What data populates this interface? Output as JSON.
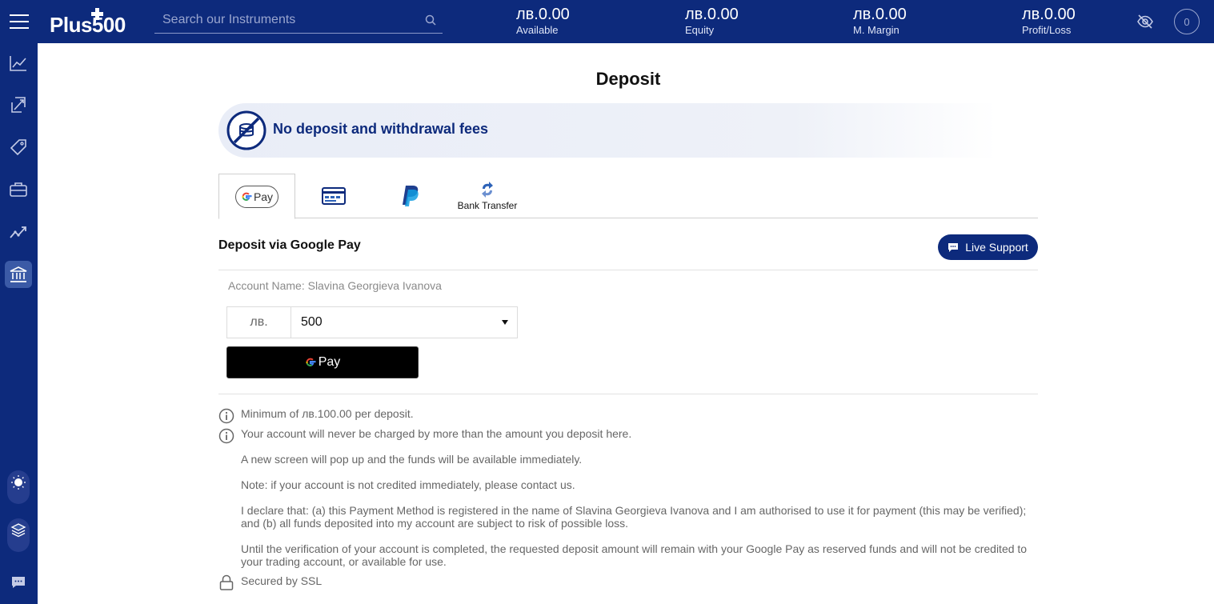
{
  "colors": {
    "brand_navy": "#0d2a7c",
    "sidebar_active": "#3b5aa6",
    "banner_bg": "#e9edf7",
    "note_text": "#666666"
  },
  "header": {
    "logo_text": "Plus500",
    "search_placeholder": "Search our Instruments",
    "stats": [
      {
        "value": "лв.0.00",
        "label": "Available"
      },
      {
        "value": "лв.0.00",
        "label": "Equity"
      },
      {
        "value": "лв.0.00",
        "label": "M. Margin"
      },
      {
        "value": "лв.0.00",
        "label": "Profit/Loss"
      }
    ],
    "notification_count": "0",
    "icons": [
      "hamburger-menu-icon",
      "search-icon",
      "eye-off-icon"
    ]
  },
  "sidebar": {
    "items": [
      {
        "icon": "chart-line-icon",
        "active": false
      },
      {
        "icon": "swap-arrows-icon",
        "active": false
      },
      {
        "icon": "price-tag-icon",
        "active": false
      },
      {
        "icon": "briefcase-icon",
        "active": false
      },
      {
        "icon": "trend-icon",
        "active": false
      },
      {
        "icon": "bank-icon",
        "active": true
      }
    ],
    "bottom": [
      "theme-toggle-icon",
      "layers-icon",
      "chat-icon"
    ]
  },
  "main": {
    "title": "Deposit",
    "banner_text": "No deposit and withdrawal fees",
    "tabs": [
      {
        "id": "google-pay",
        "label": "Pay",
        "active": true
      },
      {
        "id": "card",
        "label": "",
        "active": false
      },
      {
        "id": "paypal",
        "label": "",
        "active": false
      },
      {
        "id": "bank-transfer",
        "label": "Bank Transfer",
        "active": false
      }
    ],
    "section_title": "Deposit via Google Pay",
    "live_support_label": "Live Support",
    "account_name": "Account Name: Slavina Georgieva Ivanova",
    "currency": "лв.",
    "amount": "500",
    "gpay_button_label": "Pay",
    "notes": [
      "Minimum of лв.100.00 per deposit.",
      "Your account will never be charged by more than the amount you deposit here.",
      "A new screen will pop up and the funds will be available immediately.",
      "Note: if your account is not credited immediately, please contact us.",
      "I declare that: (a) this Payment Method is registered in the name of Slavina Georgieva Ivanova and I am authorised to use it for payment (this may be verified); and (b) all funds deposited into my account are subject to risk of possible loss.",
      "Until the verification of your account is completed, the requested deposit amount will remain with your Google Pay as reserved funds and will not be credited to your trading account, or available for use."
    ],
    "secured_text": "Secured by SSL"
  }
}
